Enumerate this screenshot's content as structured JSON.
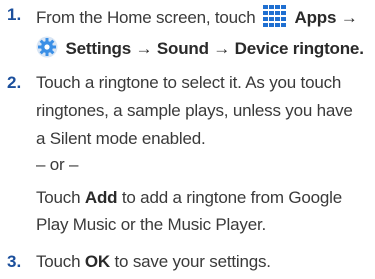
{
  "steps": [
    {
      "number": "1.",
      "l1_pre": "From the Home screen, touch",
      "apps": "Apps",
      "arrow": "→",
      "settings": "Settings",
      "sound": "Sound",
      "device_ringtone": "Device ringtone",
      "period": "."
    },
    {
      "number": "2.",
      "lines": [
        "Touch a ringtone to select it. As you touch",
        "ringtones, a sample plays, unless you have",
        "a Silent mode enabled."
      ],
      "or": "– or –",
      "touch": "Touch",
      "add": "Add",
      "add_rest": " to add a ringtone from Google",
      "last_line": "Play Music or the Music Player."
    },
    {
      "number": "3.",
      "touch": "Touch",
      "ok": "OK",
      "rest": " to save your settings."
    }
  ],
  "icons": {
    "apps": "apps-grid-icon",
    "settings": "settings-gear-icon"
  },
  "colors": {
    "step_number": "#1b4f9c",
    "apps_icon": "#1f6fd1",
    "settings_icon": "#3a8fe6"
  }
}
